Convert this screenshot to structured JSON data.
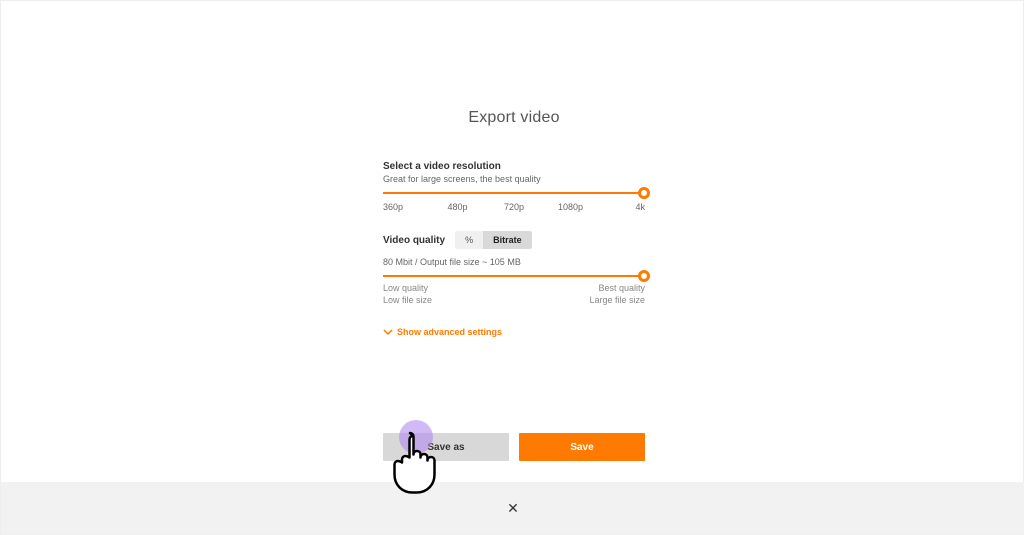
{
  "dialog": {
    "title": "Export video"
  },
  "resolution": {
    "heading": "Select a video resolution",
    "subtitle": "Great for large screens, the best quality",
    "ticks": [
      "360p",
      "480p",
      "720p",
      "1080p",
      "4k"
    ],
    "selected": "4k"
  },
  "quality": {
    "heading": "Video quality",
    "modes": {
      "percent": "%",
      "bitrate": "Bitrate"
    },
    "active_mode": "bitrate",
    "status": "80 Mbit / Output file size ~ 105 MB",
    "left_top": "Low quality",
    "left_bottom": "Low file size",
    "right_top": "Best quality",
    "right_bottom": "Large file size"
  },
  "advanced": {
    "label": "Show advanced settings"
  },
  "buttons": {
    "save_as": "Save as",
    "save": "Save"
  },
  "footer": {
    "close_glyph": "✕"
  }
}
